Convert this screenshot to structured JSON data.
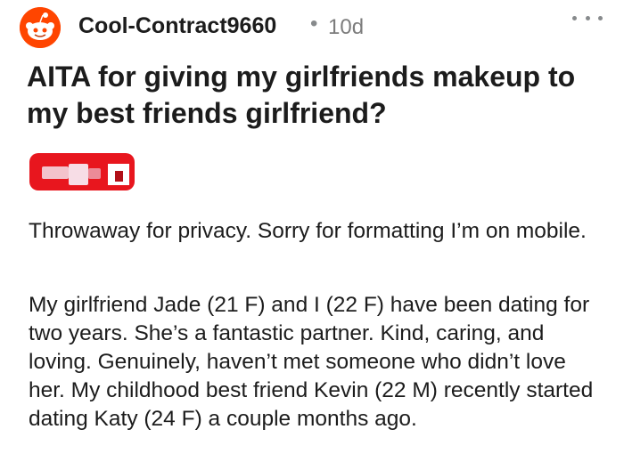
{
  "post": {
    "author": "Cool-Contract9660",
    "separator": "•",
    "age": "10d",
    "title": "AITA for giving my girlfriends makeup to my best friends girlfriend?",
    "paragraphs": [
      "Throwaway for privacy. Sorry for formatting I’m on mobile.",
      "My girlfriend Jade (21 F) and I (22 F) have been dating for two years. She’s a fantastic partner. Kind, caring, and loving. Genuinely, haven’t met someone who didn’t love her. My childhood best friend Kevin (22 M) recently started dating Katy (24 F) a couple months ago."
    ]
  },
  "icons": {
    "avatar": "reddit-snoo-icon",
    "more": "more-options-icon"
  },
  "colors": {
    "avatar_bg": "#ff4500",
    "text": "#1c1c1c",
    "meta": "#7c7c7c",
    "flair": "#e8161e"
  }
}
